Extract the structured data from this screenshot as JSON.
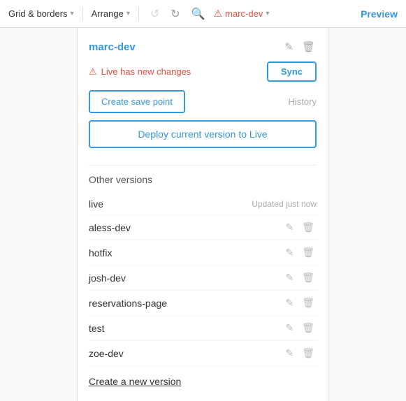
{
  "toolbar": {
    "grid_borders_label": "Grid & borders",
    "arrange_label": "Arrange",
    "undo_label": "↺",
    "redo_label": "↻",
    "search_label": "🔍",
    "alert_label": "marc-dev",
    "preview_label": "Preview"
  },
  "panel": {
    "title": "marc-dev",
    "alert_message": "Live has new changes",
    "sync_button": "Sync",
    "save_point_button": "Create save point",
    "history_link": "History",
    "deploy_button": "Deploy current version to Live",
    "other_versions_title": "Other versions",
    "versions": [
      {
        "name": "live",
        "badge": "Updated just now",
        "editable": false
      },
      {
        "name": "aless-dev",
        "badge": "",
        "editable": true
      },
      {
        "name": "hotfix",
        "badge": "",
        "editable": true
      },
      {
        "name": "josh-dev",
        "badge": "",
        "editable": true
      },
      {
        "name": "reservations-page",
        "badge": "",
        "editable": true
      },
      {
        "name": "test",
        "badge": "",
        "editable": true
      },
      {
        "name": "zoe-dev",
        "badge": "",
        "editable": true
      }
    ],
    "create_version_label": "Create a new version"
  }
}
